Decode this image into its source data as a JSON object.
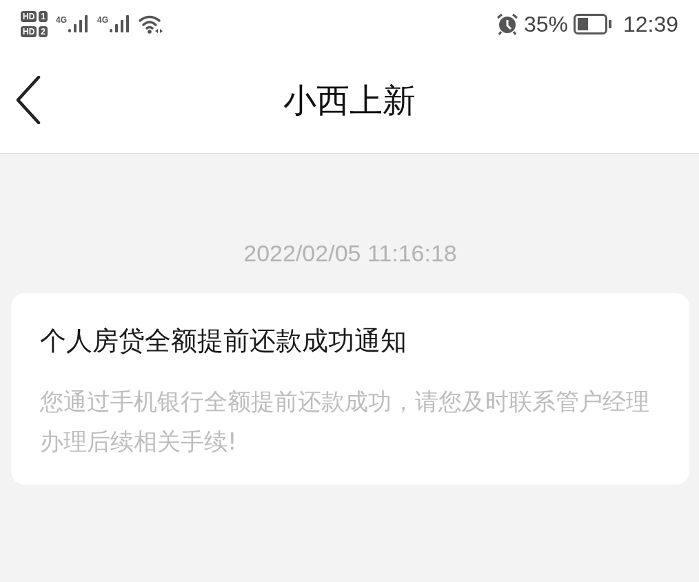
{
  "status_bar": {
    "sims": [
      {
        "badge": "HD",
        "slot": "1"
      },
      {
        "badge": "HD",
        "slot": "2"
      }
    ],
    "networks": [
      "4G",
      "4G"
    ],
    "battery": "35%",
    "time": "12:39"
  },
  "header": {
    "title": "小西上新"
  },
  "messages": [
    {
      "timestamp": "2022/02/05 11:16:18",
      "title": "个人房贷全额提前还款成功通知",
      "body": "您通过手机银行全额提前还款成功，请您及时联系管户经理办理后续相关手续!"
    }
  ]
}
